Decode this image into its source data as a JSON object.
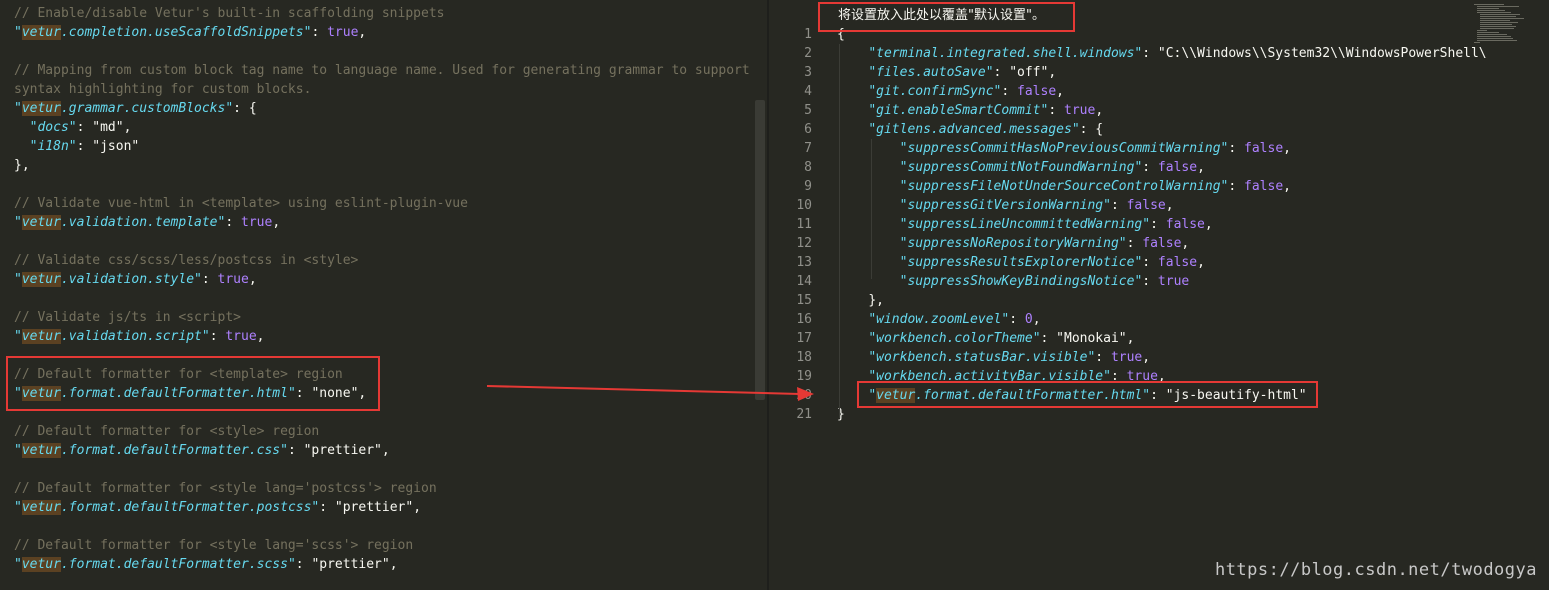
{
  "left_editor": {
    "lines": [
      {
        "type": "comment",
        "text": "// Enable/disable Vetur's built-in scaffolding snippets"
      },
      {
        "type": "kv",
        "key": "vetur.completion.useScaffoldSnippets",
        "value": "true",
        "vtype": "bool",
        "suffix": ","
      },
      {
        "type": "blank"
      },
      {
        "type": "comment",
        "text": "// Mapping from custom block tag name to language name. Used for generating grammar to support"
      },
      {
        "type": "comment",
        "text": "syntax highlighting for custom blocks."
      },
      {
        "type": "kv",
        "key": "vetur.grammar.customBlocks",
        "value": "{",
        "vtype": "punc",
        "suffix": ""
      },
      {
        "type": "kv",
        "indent": "  ",
        "plain": true,
        "key": "docs",
        "value": "\"md\"",
        "vtype": "str",
        "suffix": ","
      },
      {
        "type": "kv",
        "indent": "  ",
        "plain": true,
        "key": "i18n",
        "value": "\"json\"",
        "vtype": "str",
        "suffix": ""
      },
      {
        "type": "text",
        "text": "},"
      },
      {
        "type": "blank"
      },
      {
        "type": "comment",
        "text": "// Validate vue-html in <template> using eslint-plugin-vue"
      },
      {
        "type": "kv",
        "key": "vetur.validation.template",
        "value": "true",
        "vtype": "bool",
        "suffix": ","
      },
      {
        "type": "blank"
      },
      {
        "type": "comment",
        "text": "// Validate css/scss/less/postcss in <style>"
      },
      {
        "type": "kv",
        "key": "vetur.validation.style",
        "value": "true",
        "vtype": "bool",
        "suffix": ","
      },
      {
        "type": "blank"
      },
      {
        "type": "comment",
        "text": "// Validate js/ts in <script>"
      },
      {
        "type": "kv",
        "key": "vetur.validation.script",
        "value": "true",
        "vtype": "bool",
        "suffix": ","
      },
      {
        "type": "blank"
      },
      {
        "type": "comment",
        "text": "// Default formatter for <template> region"
      },
      {
        "type": "kv",
        "key": "vetur.format.defaultFormatter.html",
        "value": "\"none\"",
        "vtype": "str",
        "suffix": ","
      },
      {
        "type": "blank"
      },
      {
        "type": "comment",
        "text": "// Default formatter for <style> region"
      },
      {
        "type": "kv",
        "key": "vetur.format.defaultFormatter.css",
        "value": "\"prettier\"",
        "vtype": "str",
        "suffix": ","
      },
      {
        "type": "blank"
      },
      {
        "type": "comment",
        "text": "// Default formatter for <style lang='postcss'> region"
      },
      {
        "type": "kv",
        "key": "vetur.format.defaultFormatter.postcss",
        "value": "\"prettier\"",
        "vtype": "str",
        "suffix": ","
      },
      {
        "type": "blank"
      },
      {
        "type": "comment",
        "text": "// Default formatter for <style lang='scss'> region"
      },
      {
        "type": "kv",
        "key": "vetur.format.defaultFormatter.scss",
        "value": "\"prettier\"",
        "vtype": "str",
        "suffix": ","
      }
    ]
  },
  "right_editor": {
    "banner": "将设置放入此处以覆盖\"默认设置\"。",
    "lines": [
      {
        "n": "1",
        "indent": "",
        "raw": "{"
      },
      {
        "n": "2",
        "indent": "    ",
        "key": "terminal.integrated.shell.windows",
        "value": "\"C:\\\\Windows\\\\System32\\\\WindowsPowerShell\\",
        "vtype": "str",
        "suffix": ""
      },
      {
        "n": "3",
        "indent": "    ",
        "key": "files.autoSave",
        "value": "\"off\"",
        "vtype": "str",
        "suffix": ","
      },
      {
        "n": "4",
        "indent": "    ",
        "key": "git.confirmSync",
        "value": "false",
        "vtype": "bool",
        "suffix": ","
      },
      {
        "n": "5",
        "indent": "    ",
        "key": "git.enableSmartCommit",
        "value": "true",
        "vtype": "bool",
        "suffix": ","
      },
      {
        "n": "6",
        "indent": "    ",
        "key": "gitlens.advanced.messages",
        "value": "{",
        "vtype": "punc",
        "suffix": ""
      },
      {
        "n": "7",
        "indent": "        ",
        "key": "suppressCommitHasNoPreviousCommitWarning",
        "value": "false",
        "vtype": "bool",
        "suffix": ","
      },
      {
        "n": "8",
        "indent": "        ",
        "key": "suppressCommitNotFoundWarning",
        "value": "false",
        "vtype": "bool",
        "suffix": ","
      },
      {
        "n": "9",
        "indent": "        ",
        "key": "suppressFileNotUnderSourceControlWarning",
        "value": "false",
        "vtype": "bool",
        "suffix": ","
      },
      {
        "n": "10",
        "indent": "        ",
        "key": "suppressGitVersionWarning",
        "value": "false",
        "vtype": "bool",
        "suffix": ","
      },
      {
        "n": "11",
        "indent": "        ",
        "key": "suppressLineUncommittedWarning",
        "value": "false",
        "vtype": "bool",
        "suffix": ","
      },
      {
        "n": "12",
        "indent": "        ",
        "key": "suppressNoRepositoryWarning",
        "value": "false",
        "vtype": "bool",
        "suffix": ","
      },
      {
        "n": "13",
        "indent": "        ",
        "key": "suppressResultsExplorerNotice",
        "value": "false",
        "vtype": "bool",
        "suffix": ","
      },
      {
        "n": "14",
        "indent": "        ",
        "key": "suppressShowKeyBindingsNotice",
        "value": "true",
        "vtype": "bool",
        "suffix": ""
      },
      {
        "n": "15",
        "indent": "    ",
        "raw": "},"
      },
      {
        "n": "16",
        "indent": "    ",
        "key": "window.zoomLevel",
        "value": "0",
        "vtype": "num",
        "suffix": ","
      },
      {
        "n": "17",
        "indent": "    ",
        "key": "workbench.colorTheme",
        "value": "\"Monokai\"",
        "vtype": "str",
        "suffix": ","
      },
      {
        "n": "18",
        "indent": "    ",
        "key": "workbench.statusBar.visible",
        "value": "true",
        "vtype": "bool",
        "suffix": ","
      },
      {
        "n": "19",
        "indent": "    ",
        "key": "workbench.activityBar.visible",
        "value": "true",
        "vtype": "bool",
        "suffix": ","
      },
      {
        "n": "20",
        "indent": "    ",
        "key": "vetur.format.defaultFormatter.html",
        "value": "\"js-beautify-html\"",
        "vtype": "str",
        "suffix": ""
      },
      {
        "n": "21",
        "indent": "",
        "raw": "}"
      }
    ]
  },
  "highlight_word": "vetur",
  "watermark": "https://blog.csdn.net/twodogya",
  "colors": {
    "background": "#272822",
    "comment": "#75715e",
    "key": "#66d9ef",
    "boolean": "#ae81ff",
    "annotation_red": "#e53935"
  }
}
